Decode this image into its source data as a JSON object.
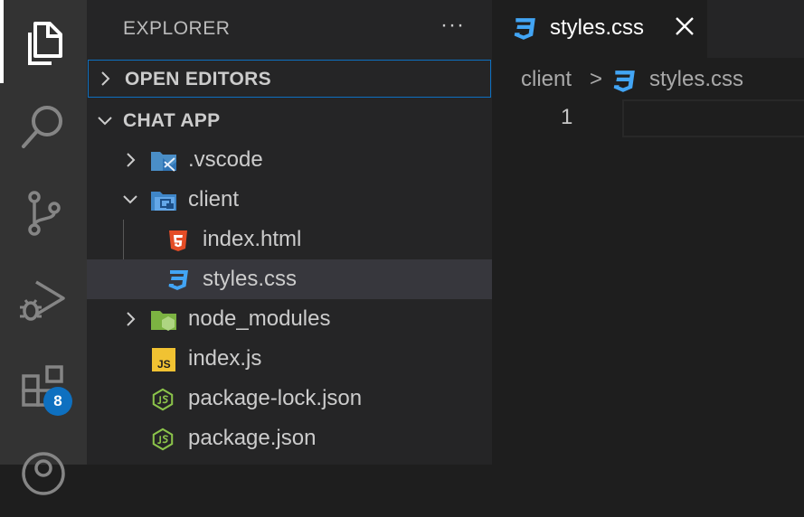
{
  "activity_bar": {
    "items": [
      {
        "icon": "files-icon",
        "active": true
      },
      {
        "icon": "search-icon"
      },
      {
        "icon": "source-control-icon"
      },
      {
        "icon": "run-debug-icon"
      },
      {
        "icon": "extensions-icon",
        "badge": "8"
      },
      {
        "icon": "accounts-icon"
      }
    ]
  },
  "sidebar": {
    "title": "EXPLORER",
    "more": "···",
    "open_editors": "OPEN EDITORS",
    "project": "CHAT APP",
    "tree": [
      {
        "name": ".vscode",
        "icon": "vscode-folder-icon",
        "depth": 1,
        "chevron": "right"
      },
      {
        "name": "client",
        "icon": "client-folder-icon",
        "depth": 1,
        "chevron": "down"
      },
      {
        "name": "index.html",
        "icon": "html5-icon",
        "depth": 2
      },
      {
        "name": "styles.css",
        "icon": "css3-icon",
        "depth": 2,
        "selected": true
      },
      {
        "name": "node_modules",
        "icon": "node-folder-icon",
        "depth": 1,
        "chevron": "right"
      },
      {
        "name": "index.js",
        "icon": "js-icon",
        "depth": 1
      },
      {
        "name": "package-lock.json",
        "icon": "nodejs-icon",
        "depth": 1
      },
      {
        "name": "package.json",
        "icon": "nodejs-icon",
        "depth": 1
      }
    ]
  },
  "editor": {
    "tab": {
      "name": "styles.css",
      "icon": "css3-icon"
    },
    "breadcrumb": {
      "folder": "client",
      "sep": ">",
      "file": "styles.css"
    },
    "line_number": "1"
  },
  "colors": {
    "accent": "#0e70c0",
    "css": "#42a5f5",
    "html": "#e44d26",
    "js": "#f1c232",
    "node": "#8bc34a"
  }
}
